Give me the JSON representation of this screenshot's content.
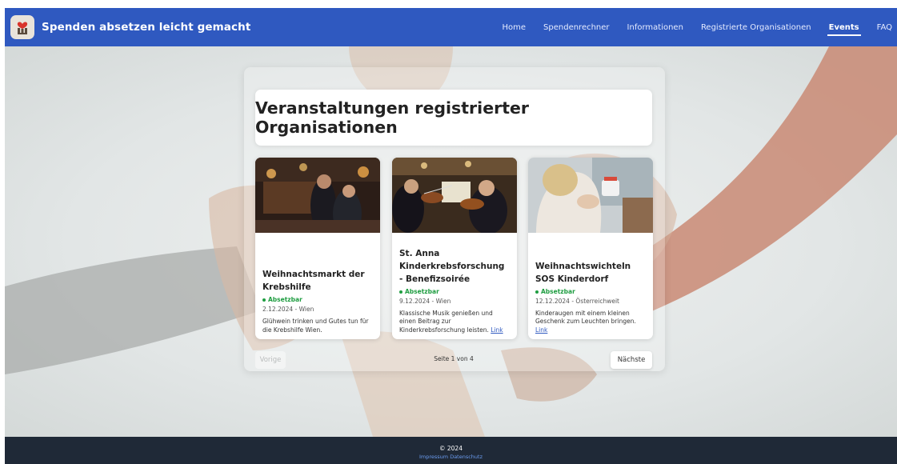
{
  "header": {
    "brand_title": "Spenden absetzen leicht gemacht",
    "nav": [
      {
        "label": "Home",
        "active": false
      },
      {
        "label": "Spendenrechner",
        "active": false
      },
      {
        "label": "Informationen",
        "active": false
      },
      {
        "label": "Registrierte Organisationen",
        "active": false
      },
      {
        "label": "Events",
        "active": true
      },
      {
        "label": "FAQ",
        "active": false
      }
    ]
  },
  "main": {
    "title": "Veranstaltungen registrierter Organisationen",
    "events": [
      {
        "title": "Weihnachtsmarkt der Krebshilfe",
        "status": "Absetzbar",
        "date_location": "2.12.2024 - Wien",
        "description": "Glühwein trinken und Gutes tun für die Krebshilfe Wien.",
        "link_label": ""
      },
      {
        "title": "St. Anna Kinderkrebsforschung - Benefizsoirée",
        "status": "Absetzbar",
        "date_location": "9.12.2024 - Wien",
        "description": "Klassische Musik genießen und einen Beitrag zur Kinderkrebsforschung leisten.",
        "link_label": "Link"
      },
      {
        "title": "Weihnachtswichteln SOS Kinderdorf",
        "status": "Absetzbar",
        "date_location": "12.12.2024 - Österreichweit",
        "description": "Kinderaugen mit einem kleinen Geschenk zum Leuchten bringen.",
        "link_label": "Link"
      }
    ],
    "pagination": {
      "prev_label": "Vorige",
      "page_info": "Seite 1 von 4",
      "next_label": "Nächste"
    }
  },
  "footer": {
    "copyright": "© 2024",
    "links": [
      "Impressum",
      "Datenschutz"
    ]
  },
  "colors": {
    "navbar": "#2f59c0",
    "footer": "#1f2937",
    "status_green": "#1f9d41",
    "link_blue": "#2f59c0"
  }
}
